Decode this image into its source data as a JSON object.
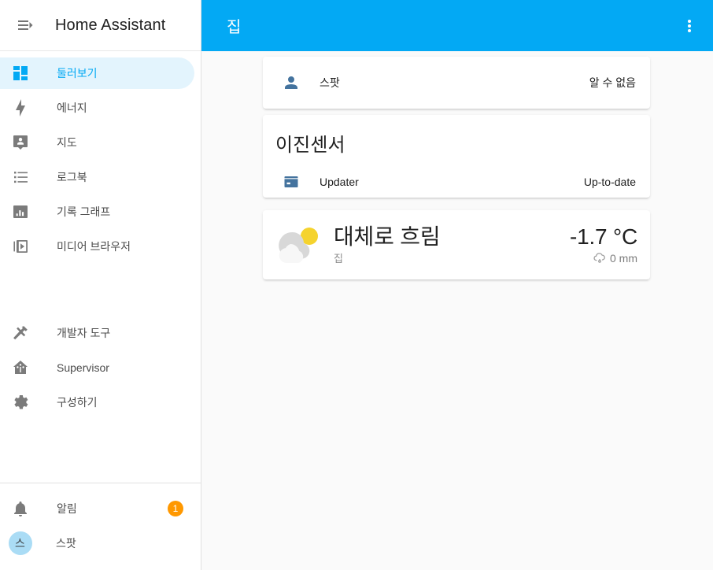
{
  "sidebar": {
    "title": "Home Assistant",
    "menu_icon": "menu-open-icon",
    "main_items": [
      {
        "label": "둘러보기",
        "icon": "view-dashboard-icon",
        "active": true
      },
      {
        "label": "에너지",
        "icon": "lightning-bolt-icon",
        "active": false
      },
      {
        "label": "지도",
        "icon": "account-badge-icon",
        "active": false
      },
      {
        "label": "로그북",
        "icon": "format-list-bulleted-icon",
        "active": false
      },
      {
        "label": "기록 그래프",
        "icon": "chart-box-icon",
        "active": false
      },
      {
        "label": "미디어 브라우저",
        "icon": "play-box-outline-icon",
        "active": false
      }
    ],
    "tools_items": [
      {
        "label": "개발자 도구",
        "icon": "hammer-wrench-icon"
      },
      {
        "label": "Supervisor",
        "icon": "home-assistant-supervisor-icon"
      },
      {
        "label": "구성하기",
        "icon": "cog-icon"
      }
    ],
    "bottom_items": [
      {
        "label": "알림",
        "icon": "bell-icon",
        "badge": "1"
      },
      {
        "label": "스팟",
        "icon": "user-avatar",
        "avatar_initial": "스"
      }
    ]
  },
  "appbar": {
    "title": "집",
    "overflow_icon": "dots-vertical-icon"
  },
  "cards": {
    "person_card": {
      "rows": [
        {
          "icon": "account-icon",
          "name": "스팟",
          "state": "알 수 없음"
        }
      ]
    },
    "binary_sensor_card": {
      "title": "이진센서",
      "rows": [
        {
          "icon": "package-icon",
          "name": "Updater",
          "state": "Up-to-date"
        }
      ]
    },
    "weather_card": {
      "icon": "partly-cloudy-icon",
      "condition": "대체로 흐림",
      "location": "집",
      "temperature": "-1.7 °C",
      "precipitation": "0 mm",
      "precip_icon": "weather-rainy-icon"
    }
  },
  "colors": {
    "accent": "#03a9f4",
    "active_nav_bg": "#e3f4fd",
    "badge": "#ff9800",
    "entity_icon": "#44739e",
    "avatar_bg": "#aadcf5",
    "sun": "#f5d32e",
    "cloud_back": "#d8d8d8",
    "cloud_front": "#f7f7f7"
  }
}
